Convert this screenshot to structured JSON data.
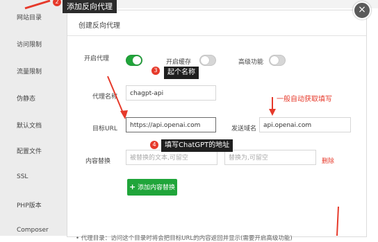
{
  "sidebar": {
    "items": [
      {
        "label": "网站目录"
      },
      {
        "label": "访问限制"
      },
      {
        "label": "流量限制"
      },
      {
        "label": "伪静态"
      },
      {
        "label": "默认文档"
      },
      {
        "label": "配置文件"
      },
      {
        "label": "SSL"
      },
      {
        "label": "PHP版本"
      },
      {
        "label": "Composer"
      }
    ]
  },
  "dialog": {
    "title_tag": "添加反向代理",
    "tab_label": "创建反向代理",
    "close_glyph": "×",
    "toggles": {
      "enable_proxy": {
        "label": "开启代理",
        "on": true
      },
      "enable_cache": {
        "label": "开启缓存",
        "on": false
      },
      "advanced": {
        "label": "高级功能",
        "on": false
      }
    },
    "proxy_name": {
      "label": "代理名称",
      "value": "chagpt-api"
    },
    "target_url": {
      "label": "目标URL",
      "value": "https://api.openai.com"
    },
    "send_domain": {
      "label": "发送域名",
      "value": "api.openai.com"
    },
    "content_replace": {
      "label": "内容替换",
      "from_placeholder": "被替换的文本,可留空",
      "to_placeholder": "替换为,可留空",
      "delete_label": "删除"
    },
    "add_button": {
      "icon": "+",
      "label": "添加内容替换"
    },
    "hint": "• 代理目录：访问这个目录时将会把目标URL的内容返回并显示(需要开启高级功能)"
  },
  "annotations": {
    "step2": {
      "number": "2"
    },
    "step3": {
      "number": "3",
      "text": "起个名称"
    },
    "step4": {
      "number": "4",
      "text": "填写ChatGPT的地址"
    },
    "auto_note": "一般自动获取填写"
  },
  "colors": {
    "accent_green": "#20a53a",
    "annotation_red": "#e63a2b",
    "callout_bg": "#1f1f1f"
  }
}
